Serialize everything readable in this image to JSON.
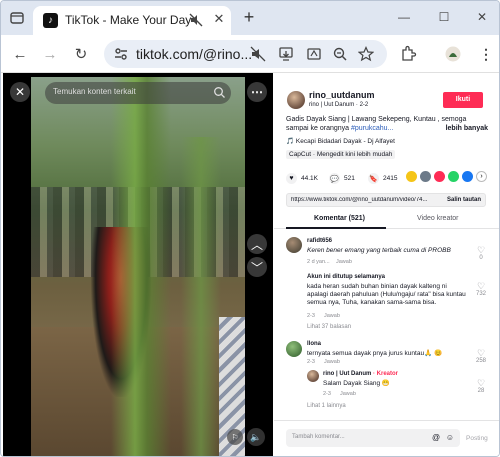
{
  "browser": {
    "tab_title": "TikTok - Make Your Day",
    "url": "tiktok.com/@rino...",
    "favicon": "tiktok-icon"
  },
  "video": {
    "search_placeholder": "Temukan konten terkait",
    "icons": [
      "close-icon",
      "more-icon",
      "search-icon",
      "chevron-up-icon",
      "chevron-down-icon",
      "mute-icon",
      "report-icon"
    ]
  },
  "author": {
    "handle": "rino_uutdanum",
    "subtitle": "rino | Uut Danum · 2-2",
    "follow_label": "Ikuti"
  },
  "description": {
    "text": "Gadis Dayak Siang | Lawang Sekepeng, Kuntau , semoga sampai ke orangnya ",
    "hashtag": "#purukcahu...",
    "more": "lebih banyak"
  },
  "music": "🎵 Kecapi Bidadari Dayak - Dj Alfayet",
  "capcut": "CapCut · Mengedit kini lebih mudah",
  "stats": {
    "likes": "44.1K",
    "comments": "521",
    "saves": "2415"
  },
  "link": {
    "url": "https://www.tiktok.com/@rino_uutdanum/video/74...",
    "copy_label": "Salin tautan"
  },
  "tabs": {
    "comments": "Komentar (521)",
    "creator_videos": "Video kreator"
  },
  "comments": [
    {
      "name": "rafidt656",
      "text": "Keren bener emang yang terbaik cuma di PROBB",
      "meta": "2 d yan...",
      "reply": "Jawab",
      "likes": "0"
    },
    {
      "name": "Akun ini ditutup selamanya",
      "text": "kada heran sudah buhan binian dayak kalteng ni apalagi daerah pahuluan (Hulu/ngaju/ rata\" bisa kuntau semua nya, Tuha, kanakan sama-sama bisa.",
      "meta": "2-3",
      "reply": "Jawab",
      "likes": "732",
      "more": "Lihat 37 balasan"
    },
    {
      "name": "Ilona",
      "text": "ternyata semua dayak pnya jurus kuntau🙏 😊",
      "meta": "2-3",
      "reply": "Jawab",
      "likes": "258",
      "more": "Lihat 1 lainnya"
    }
  ],
  "creator_reply": {
    "name": "rino | Uut Danum",
    "badge": "· Kreator",
    "text": "Salam Dayak Siang 😁",
    "meta": "2-3",
    "reply": "Jawab",
    "likes": "28"
  },
  "comment_bar": {
    "placeholder": "Tambah komentar...",
    "post_label": "Posting"
  }
}
